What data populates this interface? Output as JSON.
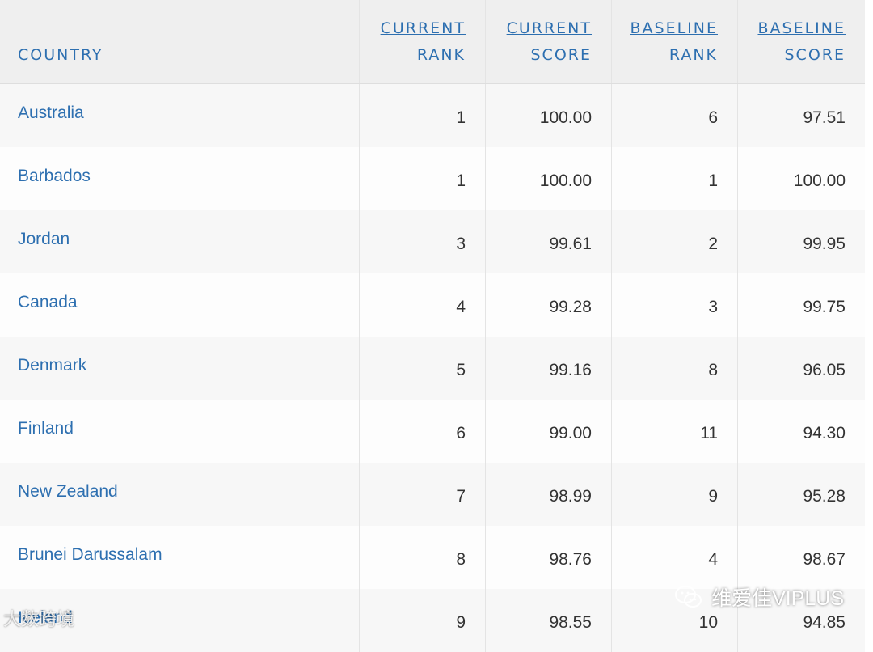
{
  "table": {
    "headers": [
      {
        "line1": "",
        "line2": "COUNTRY"
      },
      {
        "line1": "CURRENT",
        "line2": "RANK"
      },
      {
        "line1": "CURRENT",
        "line2": "SCORE"
      },
      {
        "line1": "BASELINE",
        "line2": "RANK"
      },
      {
        "line1": "BASELINE",
        "line2": "SCORE"
      }
    ],
    "rows": [
      {
        "country": "Australia",
        "current_rank": "1",
        "current_score": "100.00",
        "baseline_rank": "6",
        "baseline_score": "97.51"
      },
      {
        "country": "Barbados",
        "current_rank": "1",
        "current_score": "100.00",
        "baseline_rank": "1",
        "baseline_score": "100.00"
      },
      {
        "country": "Jordan",
        "current_rank": "3",
        "current_score": "99.61",
        "baseline_rank": "2",
        "baseline_score": "99.95"
      },
      {
        "country": "Canada",
        "current_rank": "4",
        "current_score": "99.28",
        "baseline_rank": "3",
        "baseline_score": "99.75"
      },
      {
        "country": "Denmark",
        "current_rank": "5",
        "current_score": "99.16",
        "baseline_rank": "8",
        "baseline_score": "96.05"
      },
      {
        "country": "Finland",
        "current_rank": "6",
        "current_score": "99.00",
        "baseline_rank": "11",
        "baseline_score": "94.30"
      },
      {
        "country": "New Zealand",
        "current_rank": "7",
        "current_score": "98.99",
        "baseline_rank": "9",
        "baseline_score": "95.28"
      },
      {
        "country": "Brunei Darussalam",
        "current_rank": "8",
        "current_score": "98.76",
        "baseline_rank": "4",
        "baseline_score": "98.67"
      },
      {
        "country": "Iceland",
        "current_rank": "9",
        "current_score": "98.55",
        "baseline_rank": "10",
        "baseline_score": "94.85"
      }
    ]
  },
  "watermarks": {
    "left_text": "大数跨境",
    "right_text": "维爱佳VIPLUS",
    "right_icon": "wechat-icon"
  },
  "colors": {
    "link": "#2d6fb0",
    "header_bg": "#efefef",
    "row_odd": "#f7f7f7",
    "row_even": "#fdfdfd"
  }
}
